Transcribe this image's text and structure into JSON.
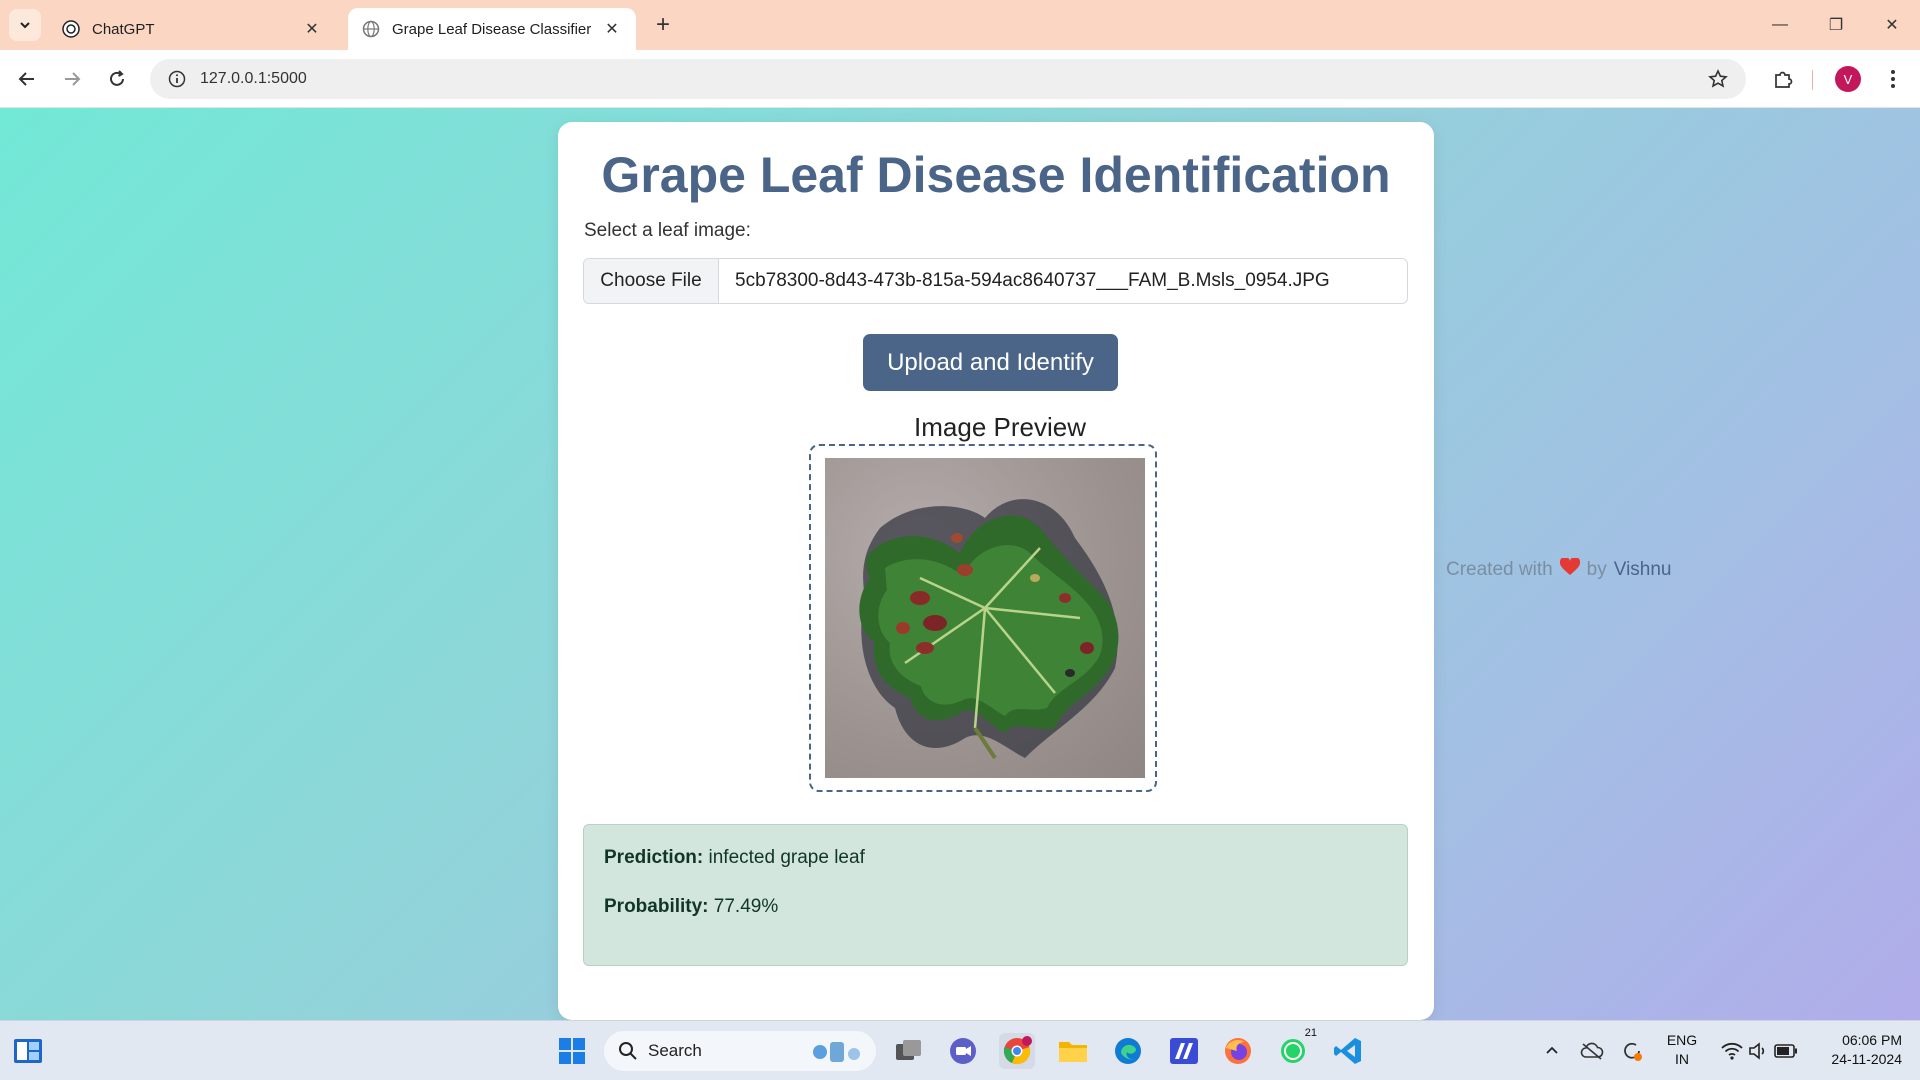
{
  "browser": {
    "tabs": [
      {
        "title": "ChatGPT",
        "active": false
      },
      {
        "title": "Grape Leaf Disease Classifier",
        "active": true
      }
    ],
    "url": "127.0.0.1:5000",
    "profile_initial": "V"
  },
  "page": {
    "title": "Grape Leaf Disease Identification",
    "file_label": "Select a leaf image:",
    "choose_file_label": "Choose File",
    "file_name": "5cb78300-8d43-473b-815a-594ac8640737___FAM_B.Msls_0954.JPG",
    "upload_button": "Upload and Identify",
    "preview_title": "Image Preview",
    "result": {
      "prediction_label": "Prediction:",
      "prediction_value": "infected grape leaf",
      "probability_label": "Probability:",
      "probability_value": "77.49%"
    },
    "credit": {
      "prefix": "Created with",
      "by": "by",
      "author": "Vishnu"
    }
  },
  "taskbar": {
    "search_label": "Search",
    "whatsapp_badge": "21",
    "language": "ENG",
    "region": "IN",
    "time": "06:06 PM",
    "date": "24-11-2024"
  },
  "colors": {
    "accent": "#4a6587",
    "result_bg": "#d2e6dd",
    "heart": "#e53935"
  }
}
